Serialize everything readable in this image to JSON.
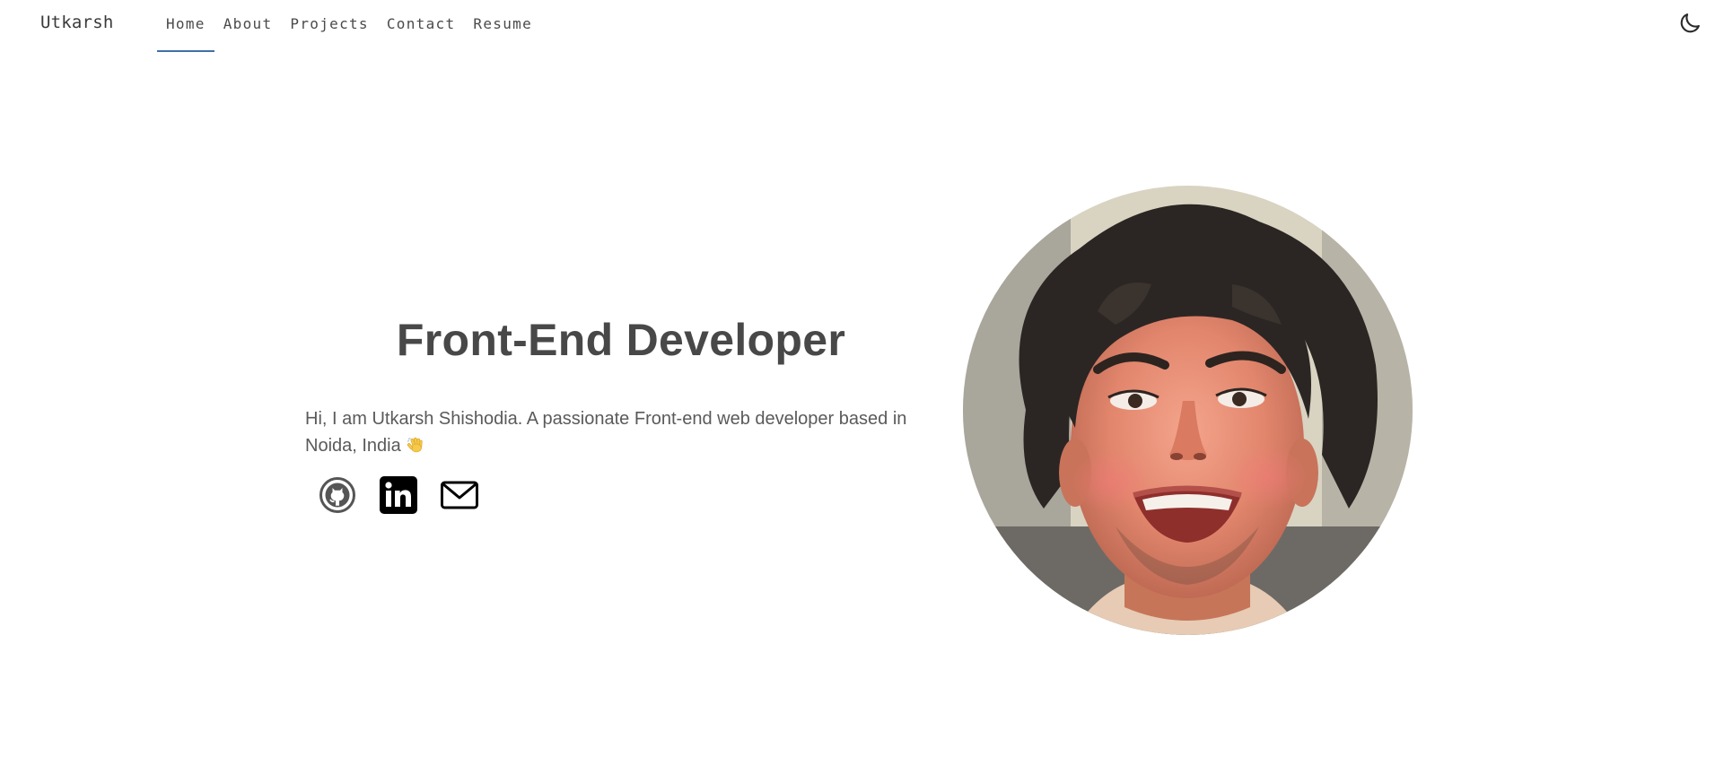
{
  "header": {
    "brand": "Utkarsh",
    "nav": [
      {
        "label": "Home",
        "active": true
      },
      {
        "label": "About",
        "active": false
      },
      {
        "label": "Projects",
        "active": false
      },
      {
        "label": "Contact",
        "active": false
      },
      {
        "label": "Resume",
        "active": false
      }
    ],
    "theme_toggle_icon": "moon-icon"
  },
  "hero": {
    "title": "Front-End Developer",
    "intro": "Hi, I am Utkarsh Shishodia. A passionate Front-end web developer based in Noida, India",
    "intro_emoji_icon": "waving-hand-icon",
    "social": [
      {
        "icon": "github-icon"
      },
      {
        "icon": "linkedin-icon"
      },
      {
        "icon": "mail-icon"
      }
    ],
    "portrait_icon": "profile-portrait"
  },
  "colors": {
    "accent_underline": "#3f6fa8",
    "text": "#4a4a4a",
    "background": "#ffffff"
  }
}
